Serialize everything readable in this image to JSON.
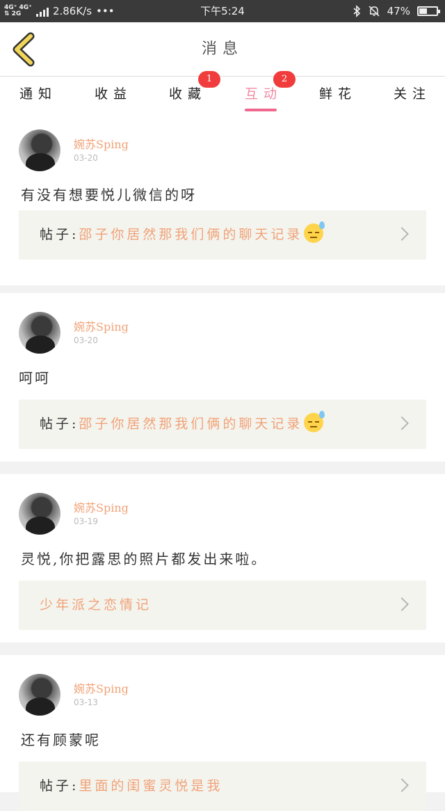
{
  "status_bar": {
    "network_top": "4G⁺ 4G⁺",
    "network_bottom": "⇅ 2G",
    "speed": "2.86K/s",
    "dots": "•••",
    "time": "下午5:24",
    "battery": "47%",
    "battery_level": 0.47
  },
  "header": {
    "title": "消息"
  },
  "tabs": [
    {
      "label": "通知",
      "badge": ""
    },
    {
      "label": "收益",
      "badge": ""
    },
    {
      "label": "收藏",
      "badge": "1"
    },
    {
      "label": "互动",
      "badge": "2",
      "active": true
    },
    {
      "label": "鲜花",
      "badge": ""
    },
    {
      "label": "关注",
      "badge": ""
    }
  ],
  "feed": [
    {
      "username": "婉苏Sping",
      "date": "03-20",
      "message": "有没有想要悦儿微信的呀",
      "ref_prefix": "帖子:",
      "ref_title": "邵子你居然那我们俩的聊天记录",
      "ref_emoji": "downcast-sweat-emoji"
    },
    {
      "username": "婉苏Sping",
      "date": "03-20",
      "message": "呵呵",
      "ref_prefix": "帖子:",
      "ref_title": "邵子你居然那我们俩的聊天记录",
      "ref_emoji": "downcast-sweat-emoji"
    },
    {
      "username": "婉苏Sping",
      "date": "03-19",
      "message": "灵悦,你把露思的照片都发出来啦。",
      "ref_prefix": "",
      "ref_title": "少年派之恋情记",
      "ref_emoji": ""
    },
    {
      "username": "婉苏Sping",
      "date": "03-13",
      "message": "还有顾蒙呢",
      "ref_prefix": "帖子:",
      "ref_title": "里面的闺蜜灵悦是我",
      "ref_emoji": ""
    }
  ],
  "colors": {
    "accent_pink": "#f0678e",
    "name_orange": "#f0a277",
    "badge_red": "#f03c3c",
    "back_yellow": "#f2d65a"
  },
  "icons": {
    "back": "back-arrow-icon",
    "chevron": "chevron-right-icon",
    "bluetooth": "bluetooth-icon",
    "mute": "bell-off-icon"
  }
}
